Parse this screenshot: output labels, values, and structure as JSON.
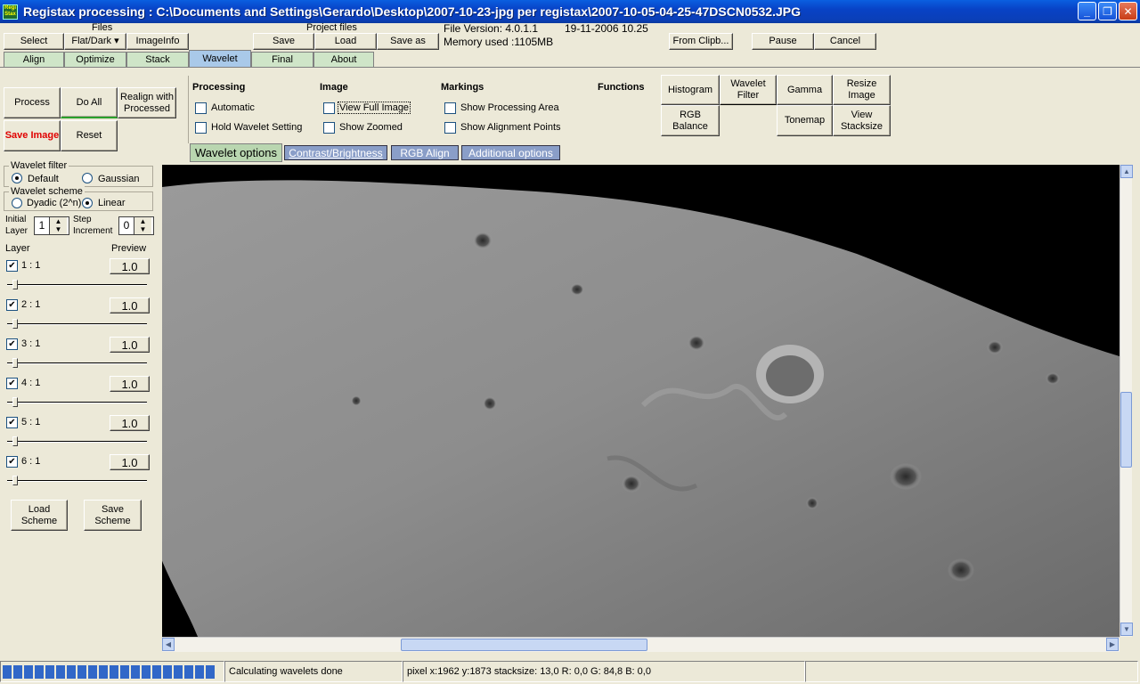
{
  "window": {
    "title": "Registax processing : C:\\Documents and Settings\\Gerardo\\Desktop\\2007-10-23-jpg per registax\\2007-10-05-04-25-47DSCN0532.JPG",
    "app_icon_text": "Regi Stax",
    "controls": {
      "minimize": "_",
      "maximize": "❐",
      "close": "✕"
    }
  },
  "toolbar": {
    "files_label": "Files",
    "select": "Select",
    "flatdark": "Flat/Dark ▾",
    "imageinfo": "ImageInfo",
    "project_label": "Project files",
    "save": "Save",
    "load": "Load",
    "save_as": "Save as",
    "file_version": "File Version: 4.0.1.1",
    "file_date": "19-11-2006 10.25",
    "memory": "Memory used :1105MB",
    "from_clipboard": "From Clipb...",
    "pause": "Pause",
    "cancel": "Cancel"
  },
  "tabs": [
    "Align",
    "Optimize",
    "Stack",
    "Wavelet",
    "Final",
    "About"
  ],
  "actions": {
    "process": "Process",
    "do_all": "Do All",
    "realign": "Realign with Processed",
    "save_image": "Save Image",
    "reset": "Reset"
  },
  "processing": {
    "title": "Processing",
    "automatic": "Automatic",
    "hold": "Hold Wavelet Setting"
  },
  "image": {
    "title": "Image",
    "full": "View Full Image",
    "zoomed": "Show Zoomed"
  },
  "markings": {
    "title": "Markings",
    "area": "Show Processing Area",
    "points": "Show Alignment Points"
  },
  "functions": {
    "title": "Functions",
    "histogram": "Histogram",
    "wavelet_filter": "Wavelet Filter",
    "gamma": "Gamma",
    "resize": "Resize Image",
    "rgb_balance": "RGB Balance",
    "tonemap": "Tonemap",
    "stacksize": "View Stacksize"
  },
  "subtabs": [
    "Wavelet options",
    "Contrast/Brightness",
    "RGB Align",
    "Additional options"
  ],
  "wavelet_filter": {
    "title": "Wavelet filter",
    "default": "Default",
    "gaussian": "Gaussian"
  },
  "wavelet_scheme": {
    "title": "Wavelet scheme",
    "dyadic": "Dyadic (2^n)",
    "linear": "Linear"
  },
  "initial_layer": {
    "label": "Initial Layer",
    "value": "1"
  },
  "step_increment": {
    "label": "Step Increment",
    "value": "0"
  },
  "layers": {
    "layer_label": "Layer",
    "preview_label": "Preview",
    "items": [
      {
        "name": "1 : 1",
        "value": "1.0"
      },
      {
        "name": "2 : 1",
        "value": "1.0"
      },
      {
        "name": "3 : 1",
        "value": "1.0"
      },
      {
        "name": "4 : 1",
        "value": "1.0"
      },
      {
        "name": "5 : 1",
        "value": "1.0"
      },
      {
        "name": "6 : 1",
        "value": "1.0"
      }
    ]
  },
  "scheme": {
    "load": "Load Scheme",
    "save": "Save Scheme"
  },
  "statusbar": {
    "message": "Calculating wavelets done",
    "pixel_info": "pixel x:1962 y:1873 stacksize: 13,0 R: 0,0 G: 84,8 B: 0,0"
  },
  "colors": {
    "save_image_text": "#e00000",
    "active_tab": "#a9c9e9",
    "tab": "#cfe5c8",
    "progress": "#3167c8"
  }
}
